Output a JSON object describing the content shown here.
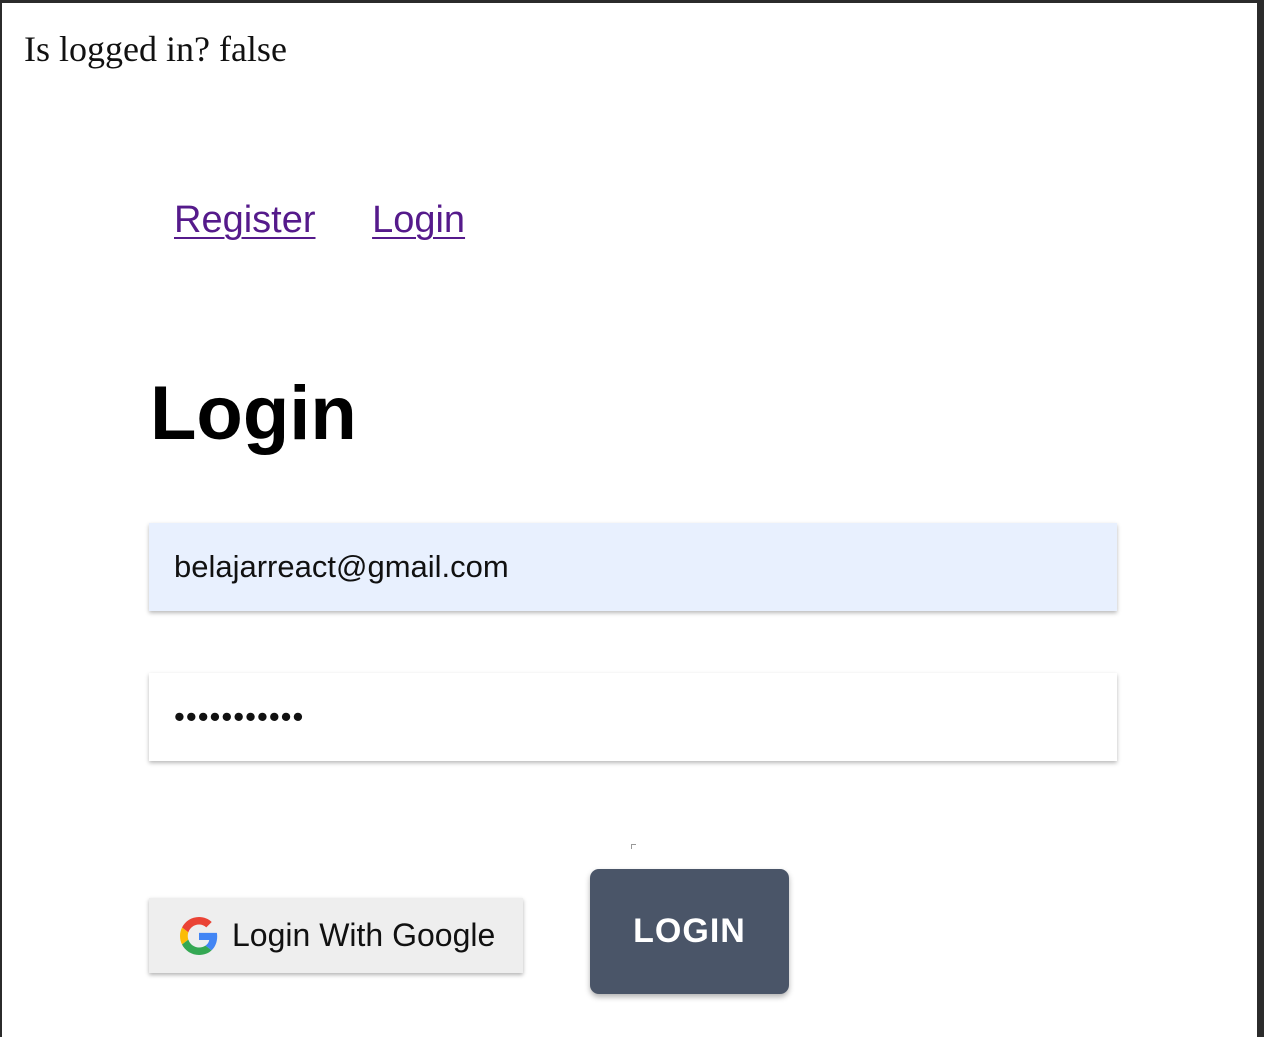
{
  "status": {
    "text": "Is logged in? false"
  },
  "nav": {
    "register_label": "Register",
    "login_label": "Login"
  },
  "page": {
    "heading": "Login"
  },
  "form": {
    "email_value": "belajarreact@gmail.com",
    "password_value": "•••••••••••",
    "google_button_label": "Login With Google",
    "google_icon": "google-g-icon",
    "login_button_label": "LOGIN"
  },
  "colors": {
    "link": "#551a8b",
    "email_autofill_bg": "#e8f0fe",
    "login_button_bg": "#4a5568",
    "google_button_bg": "#eeeeee"
  }
}
